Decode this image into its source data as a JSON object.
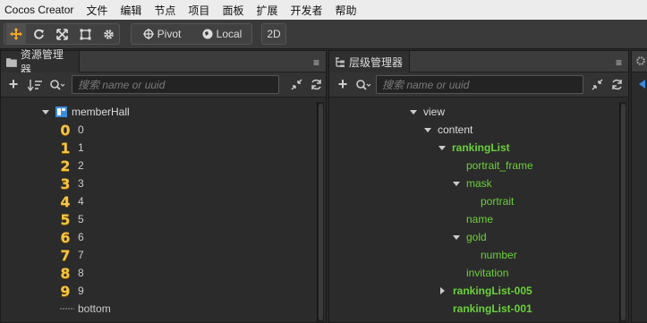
{
  "menubar": {
    "app": "Cocos Creator",
    "items": [
      "文件",
      "编辑",
      "节点",
      "项目",
      "面板",
      "扩展",
      "开发者",
      "帮助"
    ]
  },
  "toolbar": {
    "pivot_label": "Pivot",
    "local_label": "Local",
    "mode_label": "2D"
  },
  "assets_panel": {
    "title": "资源管理器",
    "menu_glyph": "≡",
    "search_placeholder": "搜索 name or uuid",
    "folder": "memberHall",
    "digits": [
      "0",
      "1",
      "2",
      "3",
      "4",
      "5",
      "6",
      "7",
      "8",
      "9"
    ],
    "extra_item": "bottom"
  },
  "hierarchy_panel": {
    "title": "层级管理器",
    "menu_glyph": "≡",
    "search_placeholder": "搜索 name or uuid",
    "nodes": {
      "view": "view",
      "content": "content",
      "rankingList": "rankingList",
      "portrait_frame": "portrait_frame",
      "mask": "mask",
      "portrait": "portrait",
      "name": "name",
      "gold": "gold",
      "number": "number",
      "invitation": "invitation",
      "rankingList005": "rankingList-005",
      "rankingList001": "rankingList-001"
    }
  },
  "colors": {
    "accent": "#f5a623",
    "node_green": "#6ad13a",
    "digit_gold": "#f5c542"
  }
}
